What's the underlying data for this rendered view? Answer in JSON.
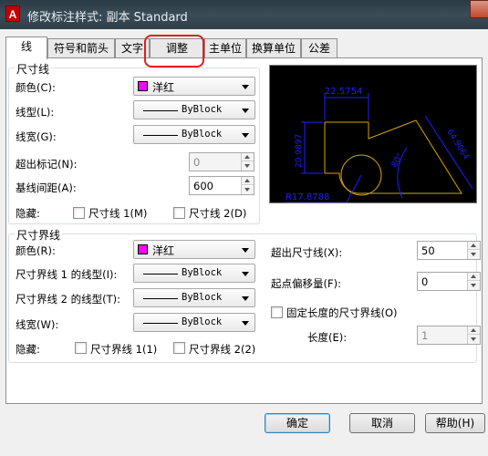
{
  "window": {
    "title": "修改标注样式: 副本 Standard",
    "app_icon": "A"
  },
  "tabs": [
    "线",
    "符号和箭头",
    "文字",
    "调整",
    "主单位",
    "换算单位",
    "公差"
  ],
  "dimension_lines": {
    "group_title": "尺寸线",
    "color_label": "颜色(C):",
    "color_value": "洋红",
    "linetype_label": "线型(L):",
    "linetype_value": "ByBlock",
    "lineweight_label": "线宽(G):",
    "lineweight_value": "ByBlock",
    "extend_label": "超出标记(N):",
    "extend_value": "0",
    "baseline_label": "基线间距(A):",
    "baseline_value": "600",
    "suppress_label": "隐藏:",
    "suppress_1": "尺寸线 1(M)",
    "suppress_2": "尺寸线 2(D)"
  },
  "extension_lines": {
    "group_title": "尺寸界线",
    "color_label": "颜色(R):",
    "color_value": "洋红",
    "linetype1_label": "尺寸界线 1 的线型(I):",
    "linetype1_value": "ByBlock",
    "linetype2_label": "尺寸界线 2 的线型(T):",
    "linetype2_value": "ByBlock",
    "lineweight_label": "线宽(W):",
    "lineweight_value": "ByBlock",
    "suppress_label": "隐藏:",
    "suppress_1": "尺寸界线 1(1)",
    "suppress_2": "尺寸界线 2(2)",
    "extend_beyond_label": "超出尺寸线(X):",
    "extend_beyond_value": "50",
    "offset_label": "起点偏移量(F):",
    "offset_value": "0",
    "fixed_length_label": "固定长度的尺寸界线(O)",
    "length_label": "长度(E):",
    "length_value": "1"
  },
  "preview": {
    "dims": [
      "22.5754",
      "20.9897",
      "64.9064",
      "80°",
      "R17.8788"
    ]
  },
  "buttons": {
    "ok": "确定",
    "cancel": "取消",
    "help": "帮助(H)"
  },
  "colors": {
    "magenta": "#ff00ff",
    "dim_blue": "#1f1fff",
    "geometry": "#d7a300",
    "highlight": "#e21e1e"
  }
}
